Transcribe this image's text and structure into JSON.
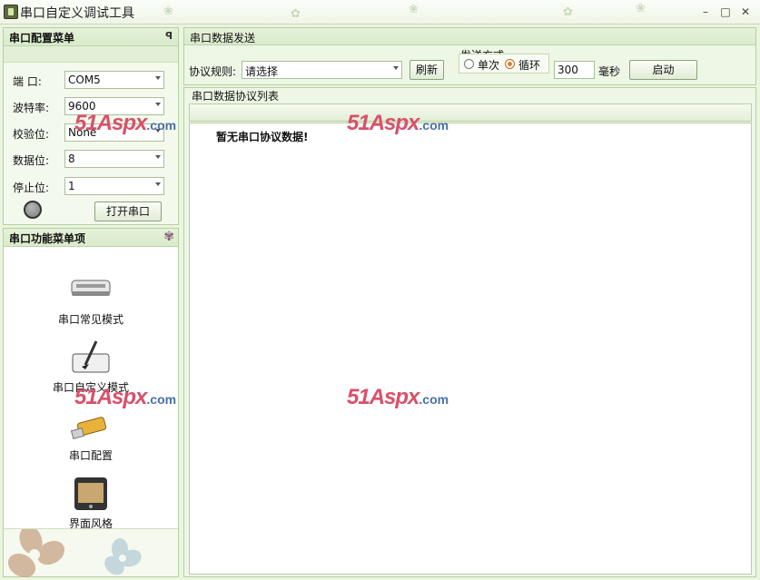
{
  "window": {
    "title": "串口自定义调试工具"
  },
  "config_panel": {
    "title": "串口配置菜单",
    "fields": [
      {
        "label": "端  口:",
        "value": "COM5"
      },
      {
        "label": "波特率:",
        "value": "9600"
      },
      {
        "label": "校验位:",
        "value": "None"
      },
      {
        "label": "数据位:",
        "value": "8"
      },
      {
        "label": "停止位:",
        "value": "1"
      }
    ],
    "open_button": "打开串口",
    "status_indicator": "closed"
  },
  "function_panel": {
    "title": "串口功能菜单项",
    "items": [
      {
        "label": "串口常见模式",
        "icon": "drive-icon"
      },
      {
        "label": "串口自定义模式",
        "icon": "pen-tablet-icon"
      },
      {
        "label": "串口配置",
        "icon": "usb-drive-icon"
      },
      {
        "label": "界面风格",
        "icon": "media-player-icon"
      }
    ]
  },
  "send_panel": {
    "title": "串口数据发送",
    "protocol_label": "协议规则:",
    "protocol_value": "请选择",
    "refresh_button": "刷新",
    "send_mode_title": "发送方式",
    "mode_single": "单次",
    "mode_loop": "循环",
    "mode_selected": "循环",
    "interval_value": "300",
    "interval_unit": "毫秒",
    "start_button": "启动"
  },
  "list_panel": {
    "title": "串口数据协议列表",
    "empty_message": "暂无串口协议数据!"
  },
  "watermark": {
    "text": "51Aspx",
    "suffix": ".com"
  },
  "colors": {
    "background": "#eaf5df",
    "accent_orange": "#e07b26",
    "watermark_red": "#d9506a"
  }
}
